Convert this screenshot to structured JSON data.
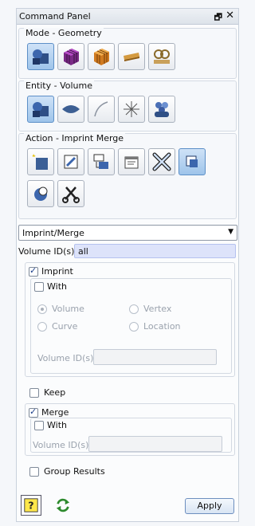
{
  "title": "Command Panel",
  "float_glyph": "🗗",
  "close_glyph": "✕",
  "mode_group": {
    "title": "Mode - Geometry",
    "buttons": [
      "geometry-mode",
      "mesh-mode",
      "mesh-grid-mode",
      "boundary-conditions-mode",
      "analysis-mode"
    ]
  },
  "entity_group": {
    "title": "Entity - Volume",
    "buttons": [
      "volume",
      "surface",
      "curve",
      "vertex",
      "group"
    ]
  },
  "action_group": {
    "title": "Action - Imprint Merge",
    "buttons": [
      "create",
      "modify",
      "transform",
      "properties",
      "delete",
      "imprint-merge",
      "boolean",
      "cut"
    ]
  },
  "operation_select": {
    "value": "Imprint/Merge"
  },
  "volume_ids": {
    "label": "Volume ID(s)",
    "value": "all"
  },
  "imprint": {
    "label": "Imprint",
    "checked": true,
    "with": {
      "label": "With",
      "checked": false,
      "radios": [
        {
          "label": "Volume",
          "checked": true
        },
        {
          "label": "Vertex",
          "checked": false
        },
        {
          "label": "Curve",
          "checked": false
        },
        {
          "label": "Location",
          "checked": false
        }
      ],
      "volume_ids_label": "Volume ID(s)",
      "volume_ids_value": ""
    }
  },
  "keep": {
    "label": "Keep",
    "checked": false
  },
  "merge": {
    "label": "Merge",
    "checked": true,
    "with": {
      "label": "With",
      "checked": false
    },
    "volume_ids_label": "Volume ID(s)",
    "volume_ids_value": ""
  },
  "group_results": {
    "label": "Group Results",
    "checked": false
  },
  "apply_label": "Apply",
  "colors": {
    "accent": "#5c8fc7",
    "active_field": "#dde3fa"
  }
}
